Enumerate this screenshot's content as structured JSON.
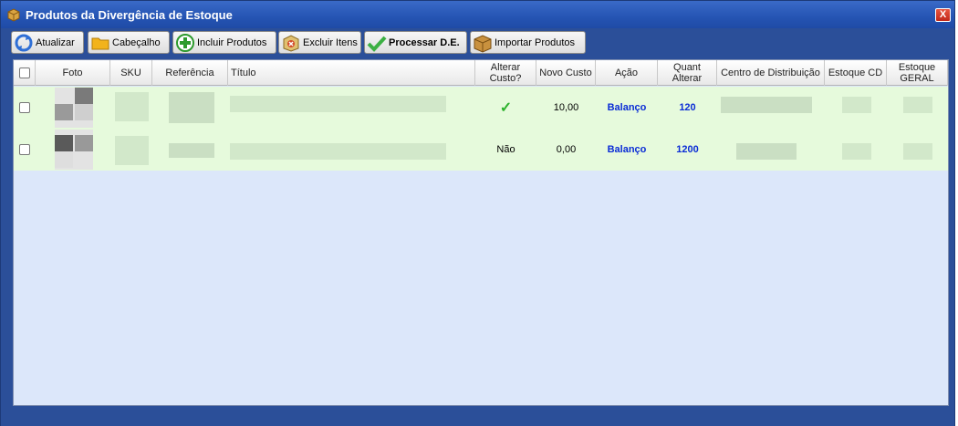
{
  "window": {
    "title": "Produtos da Divergência de Estoque",
    "close_label": "X"
  },
  "toolbar": {
    "buttons": [
      {
        "label": "Atualizar",
        "icon": "refresh-icon"
      },
      {
        "label": "Cabeçalho",
        "icon": "folder-icon"
      },
      {
        "label": "Incluir Produtos",
        "icon": "add-icon"
      },
      {
        "label": "Excluir Itens",
        "icon": "delete-icon"
      },
      {
        "label": "Processar D.E.",
        "icon": "check-icon"
      },
      {
        "label": "Importar Produtos",
        "icon": "box-icon"
      }
    ]
  },
  "table": {
    "columns": [
      "Foto",
      "SKU",
      "Referência",
      "Título",
      "Alterar Custo?",
      "Novo Custo",
      "Ação",
      "Quant Alterar",
      "Centro de Distribuição",
      "Estoque CD",
      "Estoque GERAL"
    ],
    "rows": [
      {
        "alterar_custo": "✓",
        "novo_custo": "10,00",
        "acao": "Balanço",
        "quant_alterar": "120"
      },
      {
        "alterar_custo": "Não",
        "novo_custo": "0,00",
        "acao": "Balanço",
        "quant_alterar": "1200"
      }
    ]
  },
  "colors": {
    "window_bg": "#2b4f99",
    "row_bg": "#e6fadc",
    "panel_bg": "#dce7fa",
    "link_blue": "#0a2cd6"
  }
}
